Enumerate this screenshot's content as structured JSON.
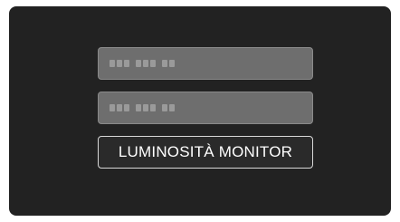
{
  "menu": {
    "items": [
      {
        "label": "",
        "state": "disabled"
      },
      {
        "label": "",
        "state": "disabled"
      },
      {
        "label": "LUMINOSITÀ MONITOR",
        "state": "selected"
      }
    ]
  },
  "colors": {
    "screen_background": "#222222",
    "disabled_item_background": "#6e6e6e",
    "selected_item_border": "#d8d8d8",
    "text": "#ffffff"
  }
}
